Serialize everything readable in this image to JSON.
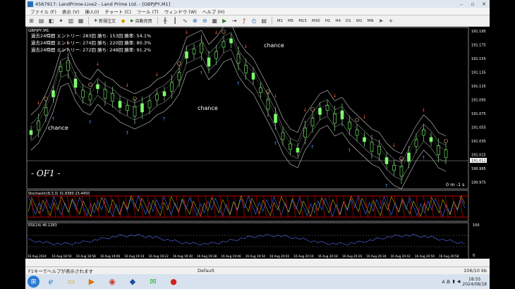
{
  "titlebar": {
    "title": "4567917: LandPrime-Live2 - Land Prime Ltd. - [GBPJPY,M1]"
  },
  "menu": [
    "ファイル (F)",
    "表示 (V)",
    "挿入(I)",
    "チャート (C)",
    "ツール (T)",
    "ウィンドウ (W)",
    "ヘルプ (H)"
  ],
  "toolbar": {
    "new_order": "新規注文",
    "auto_trade": "自動売買",
    "timeframes": [
      "M1",
      "M5",
      "M15",
      "M30",
      "H1",
      "H4",
      "D1",
      "W1",
      "MN"
    ]
  },
  "chart": {
    "symbol": "GBPJPY,M1",
    "stats": [
      "過去24時間  エントリー: 283回  勝ち: 153回  勝率: 54.1%",
      "過去24時間  エントリー: 274回  勝ち: 220回  勝率: 80.3%",
      "過去24時間  エントリー: 272回  勝ち: 248回  勝率: 91.2%"
    ],
    "labels": [
      "chance",
      "chance",
      "chance"
    ],
    "watermark": "- OF1 -",
    "timer": "0 m -1 s",
    "price_ticks": [
      "191.195",
      "191.175",
      "191.155",
      "191.135",
      "191.115",
      "191.095",
      "191.075",
      "191.055",
      "191.035",
      "191.015",
      "190.995",
      "190.975"
    ],
    "current_price": "191.011",
    "osc_label": "Stochastic(8,3,3) 31.8380 23.4450",
    "osc_ticks": [
      "100",
      "0"
    ],
    "rsi_label": "RSI(14) 46.1283",
    "rsi_ticks": [
      "100",
      "0"
    ],
    "time_ticks": [
      "16 Aug 2024",
      "16 Aug 18:50",
      "16 Aug 18:58",
      "16 Aug 19:06",
      "16 Aug 19:14",
      "16 Aug 19:22",
      "16 Aug 19:30",
      "16 Aug 19:38",
      "16 Aug 19:46",
      "16 Aug 19:54",
      "16 Aug 20:02",
      "16 Aug 20:10",
      "16 Aug 20:18",
      "16 Aug 20:26",
      "16 Aug 20:34",
      "16 Aug 20:42",
      "16 Aug 20:50",
      "16 Aug 20:58"
    ]
  },
  "status": {
    "help": "F1キーでヘルプが表示されます",
    "profile": "Default",
    "traffic": "106/10 kb"
  },
  "taskbar": {
    "time": "18:55",
    "date": "2024/08/18",
    "lang": "A あ"
  }
}
